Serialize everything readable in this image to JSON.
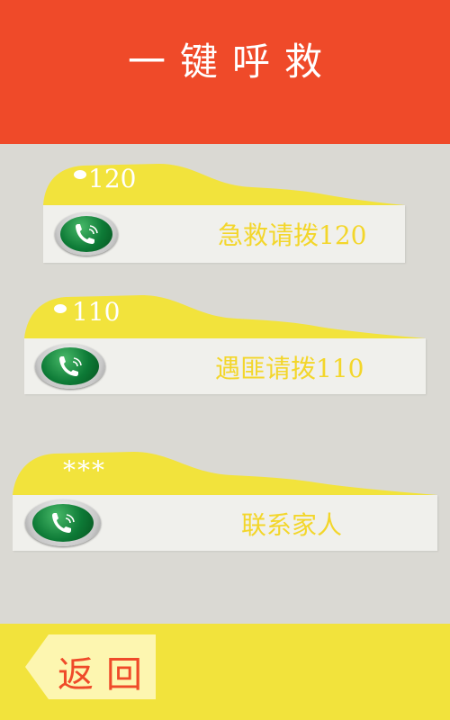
{
  "header": {
    "title": "一键呼救"
  },
  "calls": [
    {
      "tab": "120",
      "label": "急救请拨120",
      "icon": "phone-call-icon"
    },
    {
      "tab": "110",
      "label": "遇匪请拨110",
      "icon": "phone-call-icon"
    },
    {
      "tab": "***",
      "label": "联系家人",
      "icon": "phone-call-icon"
    }
  ],
  "footer": {
    "back_label": "返回"
  },
  "colors": {
    "header": "#ef4a29",
    "accent_yellow": "#f2e33c",
    "label_yellow": "#f3d62a",
    "background": "#dad9d3",
    "card": "#f0f0ec",
    "phone_green": "#0d7a36"
  }
}
